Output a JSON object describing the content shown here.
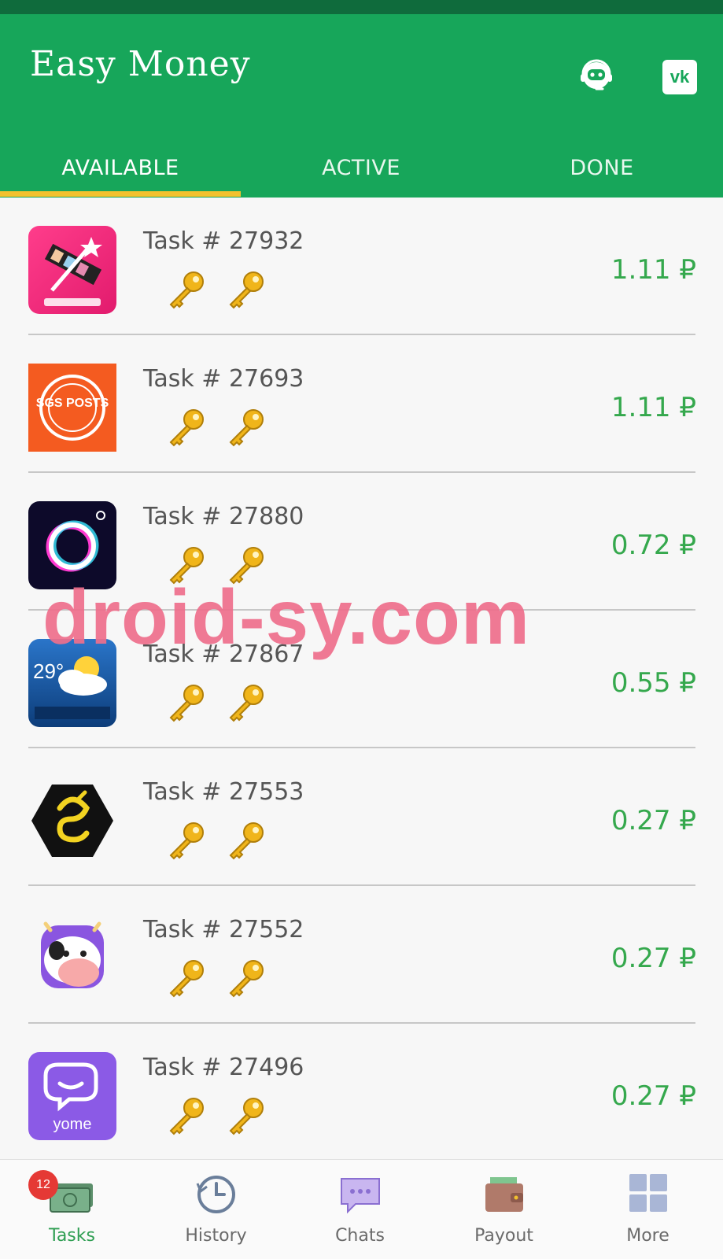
{
  "app": {
    "title": "Easy Money",
    "accent_color": "#17a65a",
    "tab_indicator_color": "#f2c12e",
    "price_color": "#35a84d"
  },
  "header_icons": {
    "support": "support-agent-icon",
    "vk": "vk-logo-icon"
  },
  "tabs": [
    {
      "label": "AVAILABLE",
      "selected": true
    },
    {
      "label": "ACTIVE",
      "selected": false
    },
    {
      "label": "DONE",
      "selected": false
    }
  ],
  "tasks": [
    {
      "label": "Task # 27932",
      "price": "1.11 ₽",
      "app_icon": "slideshow-app-icon",
      "keys": 2
    },
    {
      "label": "Task # 27693",
      "price": "1.11 ₽",
      "app_icon": "sgs-posts-app-icon",
      "keys": 2
    },
    {
      "label": "Task # 27880",
      "price": "0.72 ₽",
      "app_icon": "glitch-circle-app-icon",
      "keys": 2
    },
    {
      "label": "Task # 27867",
      "price": "0.55 ₽",
      "app_icon": "weather-app-icon",
      "keys": 2
    },
    {
      "label": "Task # 27553",
      "price": "0.27 ₽",
      "app_icon": "hexagon-logo-app-icon",
      "keys": 2
    },
    {
      "label": "Task # 27552",
      "price": "0.27 ₽",
      "app_icon": "cow-app-icon",
      "keys": 2
    },
    {
      "label": "Task # 27496",
      "price": "0.27 ₽",
      "app_icon": "yome-app-icon",
      "keys": 2
    }
  ],
  "weather_icon_text": "29°",
  "sgs_icon_text": "SGS POSTS",
  "yome_icon_text": "yome",
  "watermark": "droid-sy.com",
  "bottom_nav": {
    "tasks": {
      "label": "Tasks",
      "badge": "12",
      "icon": "money-icon"
    },
    "history": {
      "label": "History",
      "icon": "history-clock-icon"
    },
    "chats": {
      "label": "Chats",
      "icon": "chat-bubble-icon"
    },
    "payout": {
      "label": "Payout",
      "icon": "wallet-icon"
    },
    "more": {
      "label": "More",
      "icon": "grid-icon"
    }
  }
}
